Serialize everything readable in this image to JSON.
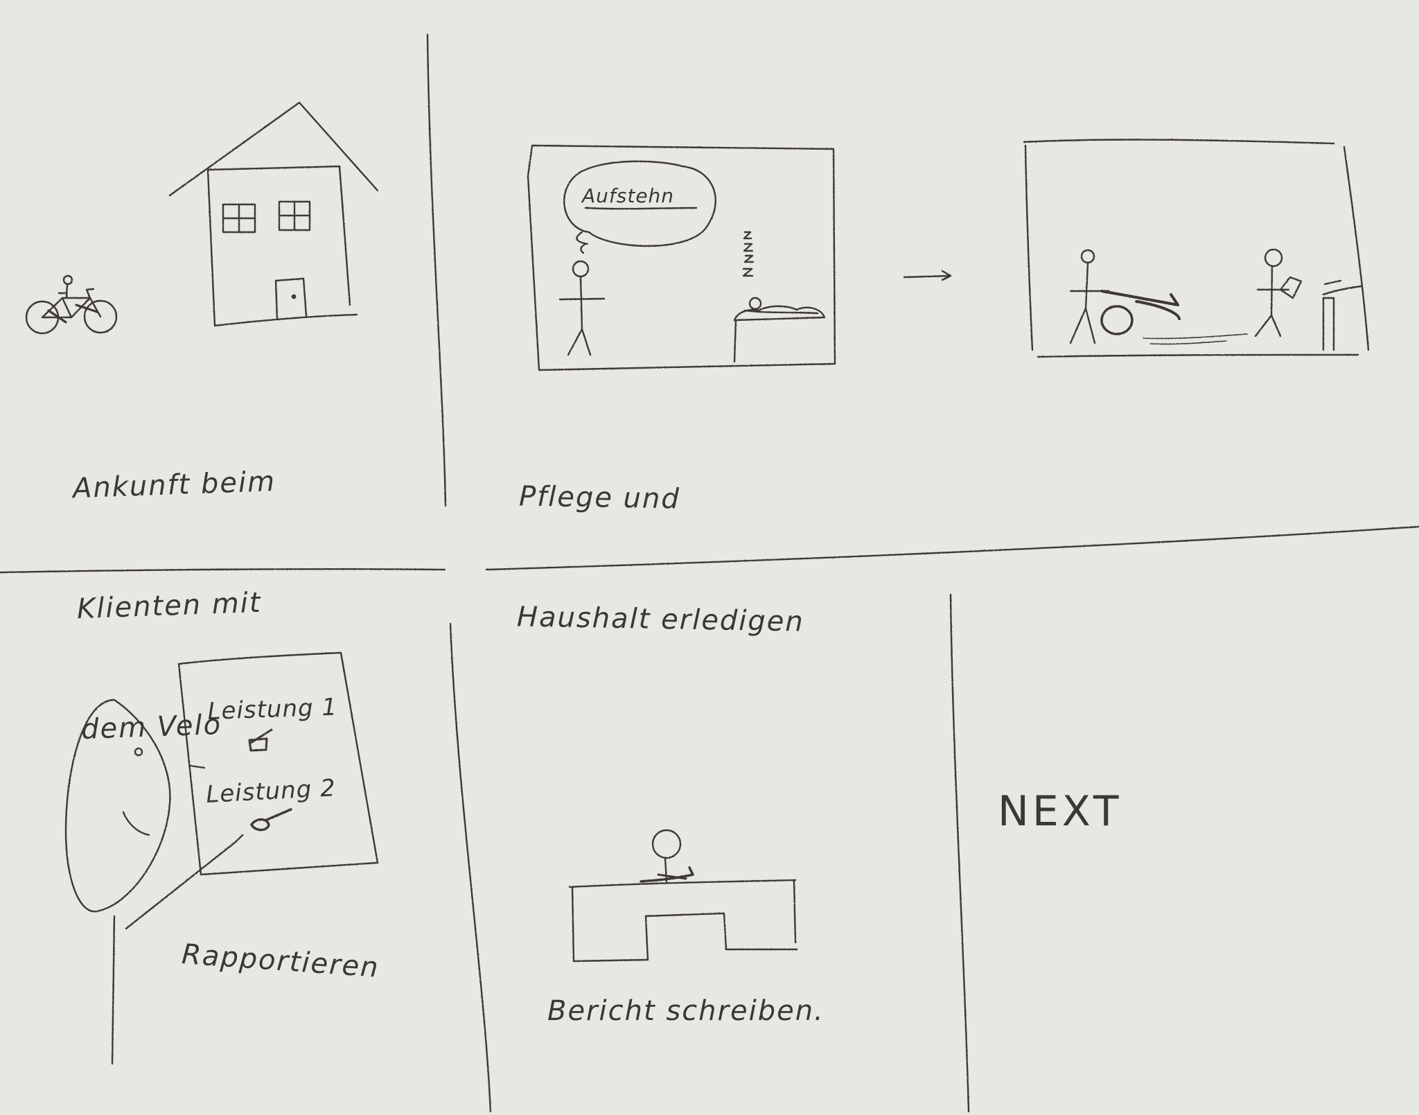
{
  "storyboard": {
    "panel_1": {
      "caption_lines": [
        "Ankunft beim",
        "Klienten mit",
        "dem Velo"
      ]
    },
    "panel_2": {
      "speech_bubble": "Aufstehn",
      "caption_lines": [
        "Pflege und",
        "Haushalt erledigen"
      ]
    },
    "panel_4": {
      "clipboard_items": [
        "Leistung 1",
        "Leistung 2"
      ],
      "caption": "Rapportieren"
    },
    "panel_5": {
      "caption": "Bericht schreiben."
    },
    "panel_6": {
      "label": "NEXT"
    }
  },
  "colors": {
    "paper": "#e9e7e2",
    "pencil": "#3a3835"
  }
}
